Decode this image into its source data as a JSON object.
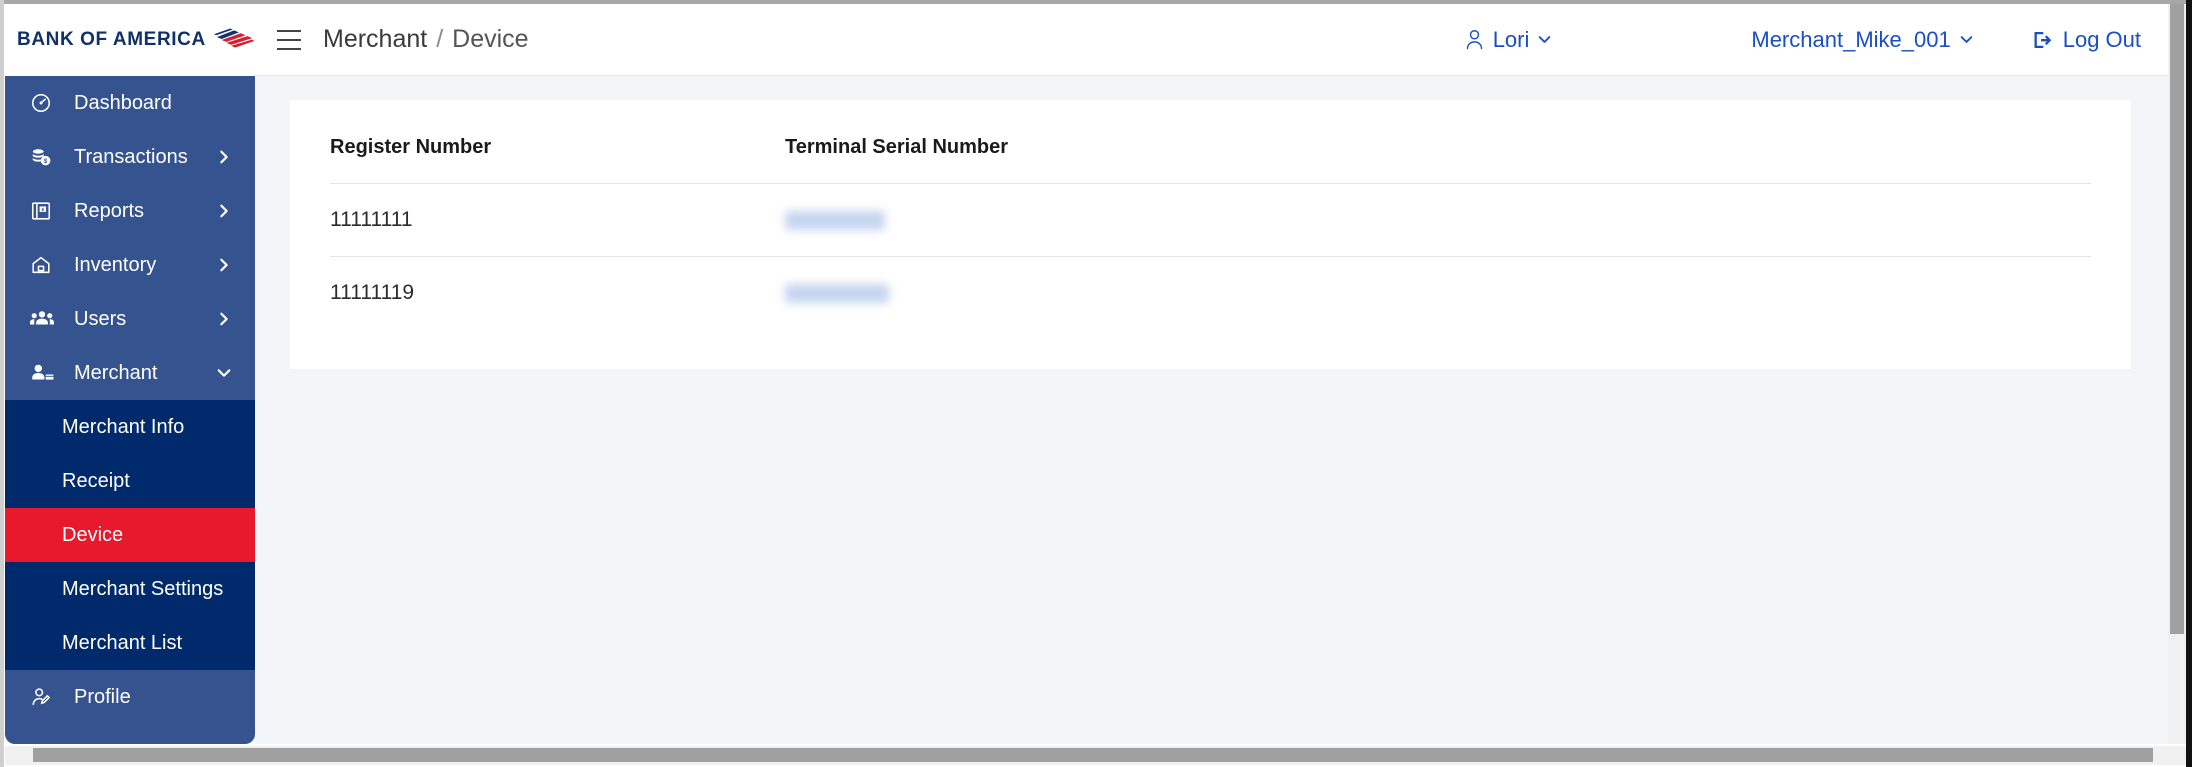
{
  "brand": {
    "name": "BANK OF AMERICA",
    "logo_icon": "bank-of-america-flag-logo"
  },
  "sidebar": {
    "items": [
      {
        "label": "Dashboard",
        "icon": "dashboard-gauge-icon",
        "chevron": "none"
      },
      {
        "label": "Transactions",
        "icon": "money-stack-icon",
        "chevron": "right"
      },
      {
        "label": "Reports",
        "icon": "report-document-icon",
        "chevron": "right"
      },
      {
        "label": "Inventory",
        "icon": "inventory-home-icon",
        "chevron": "right"
      },
      {
        "label": "Users",
        "icon": "users-group-icon",
        "chevron": "right"
      },
      {
        "label": "Merchant",
        "icon": "merchant-person-icon",
        "chevron": "down"
      }
    ],
    "submenu": {
      "parent": "Merchant",
      "items": [
        {
          "label": "Merchant Info",
          "active": false
        },
        {
          "label": "Receipt",
          "active": false
        },
        {
          "label": "Device",
          "active": true
        },
        {
          "label": "Merchant Settings",
          "active": false
        },
        {
          "label": "Merchant List",
          "active": false
        }
      ]
    },
    "footer_items": [
      {
        "label": "Profile",
        "icon": "profile-person-edit-icon",
        "chevron": "none"
      }
    ],
    "colors": {
      "nav_bg": "#34538f",
      "submenu_bg": "#002a6c",
      "active_bg": "#e8192c",
      "text": "#ffffff"
    }
  },
  "header": {
    "menu_toggle_icon": "hamburger-menu-icon",
    "breadcrumb": {
      "parent": "Merchant",
      "separator": "/",
      "current": "Device"
    },
    "user": {
      "label": "Lori",
      "icon": "user-outline-icon",
      "caret": "chevron-down-icon"
    },
    "merchant": {
      "label": "Merchant_Mike_001",
      "caret": "chevron-down-icon"
    },
    "logout": {
      "label": "Log Out",
      "icon": "logout-arrow-icon"
    },
    "link_color": "#1a4fc4"
  },
  "main": {
    "background": "#f4f5f9",
    "card": {
      "table": {
        "columns": [
          "Register Number",
          "Terminal Serial Number"
        ],
        "rows": [
          {
            "register_number": "11111111",
            "terminal_serial_number": "",
            "terminal_serial_redacted": true
          },
          {
            "register_number": "11111119",
            "terminal_serial_number": "",
            "terminal_serial_redacted": true
          }
        ]
      }
    }
  },
  "scrollbars": {
    "vertical_present": true,
    "horizontal_present": true
  }
}
